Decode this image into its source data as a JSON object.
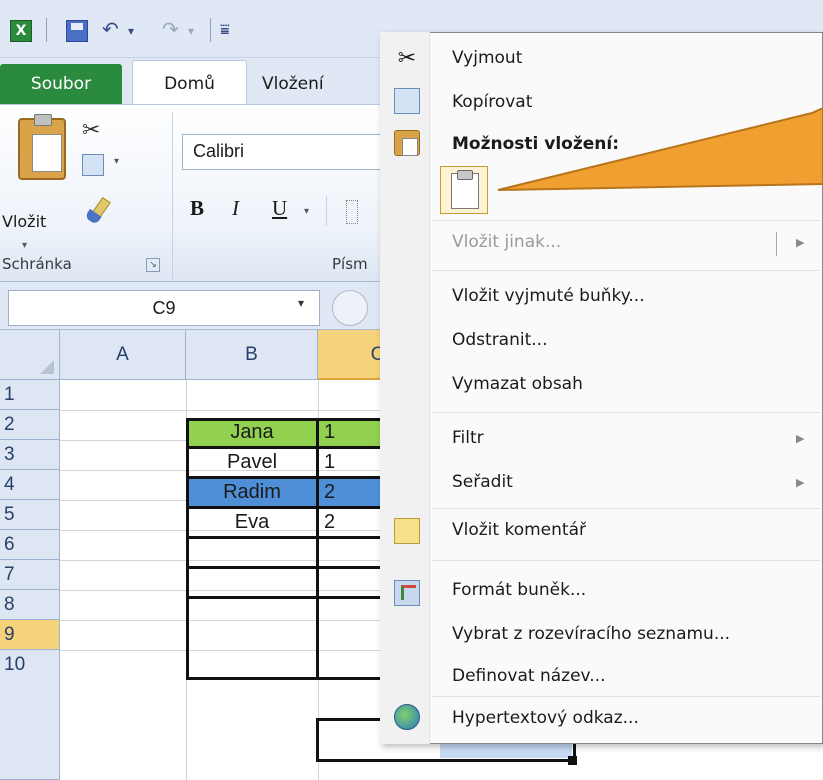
{
  "app": {
    "icon_letter": "X",
    "qat_undo": "↶",
    "qat_redo": "↷",
    "qat_caret": "▾",
    "qat_customize": "⩸"
  },
  "ribbon": {
    "tabs": [
      "Soubor",
      "Domů",
      "Vložení"
    ],
    "active_tab_index": 1,
    "clipboard": {
      "paste_label": "Vložit",
      "group_label": "Schránka",
      "launcher": "↘",
      "caret": "▾"
    },
    "font": {
      "font_name": "Calibri",
      "bold": "B",
      "italic": "I",
      "underline": "U",
      "caret": "▾",
      "group_label": "Písm"
    }
  },
  "formula_bar": {
    "name_box": "C9",
    "dropdown": "▾"
  },
  "sheet": {
    "columns": [
      "A",
      "B",
      "C"
    ],
    "selected_column": "C",
    "rows": [
      "1",
      "2",
      "3",
      "4",
      "5",
      "6",
      "7",
      "8",
      "9",
      "10"
    ],
    "selected_row": "9",
    "table": [
      {
        "name": "Jana",
        "fill": "#92d050",
        "c": "1"
      },
      {
        "name": "Pavel",
        "fill": "#ffffff",
        "c": "1"
      },
      {
        "name": "Radim",
        "fill": "#4f8fd8",
        "c": "2"
      },
      {
        "name": "Eva",
        "fill": "#ffffff",
        "c": "2"
      }
    ]
  },
  "context_menu": {
    "items": [
      {
        "label": "Vyjmout",
        "icon": "scissors-icon"
      },
      {
        "label": "Kopírovat",
        "icon": "copy-icon"
      },
      {
        "label": "Možnosti vložení:",
        "icon": "paste-icon",
        "bold": true
      },
      {
        "label": "Vložit jinak...",
        "disabled": true,
        "submenu": true
      },
      {
        "label": "Vložit vyjmuté buňky..."
      },
      {
        "label": "Odstranit..."
      },
      {
        "label": "Vymazat obsah"
      },
      {
        "label": "Filtr",
        "submenu": true
      },
      {
        "label": "Seřadit",
        "submenu": true
      },
      {
        "label": "Vložit komentář",
        "icon": "comment-icon"
      },
      {
        "label": "Formát buněk...",
        "icon": "format-cells-icon"
      },
      {
        "label": "Vybrat z rozevíracího seznamu..."
      },
      {
        "label": "Definovat název..."
      },
      {
        "label": "Hypertextový odkaz...",
        "icon": "hyperlink-icon"
      }
    ],
    "submenu_arrow": "▶"
  },
  "colors": {
    "window_green": "#4a9a3e",
    "file_tab": "#2a8a3e",
    "callout_orange": "#f0a030",
    "selection_header": "#f6d27a"
  }
}
